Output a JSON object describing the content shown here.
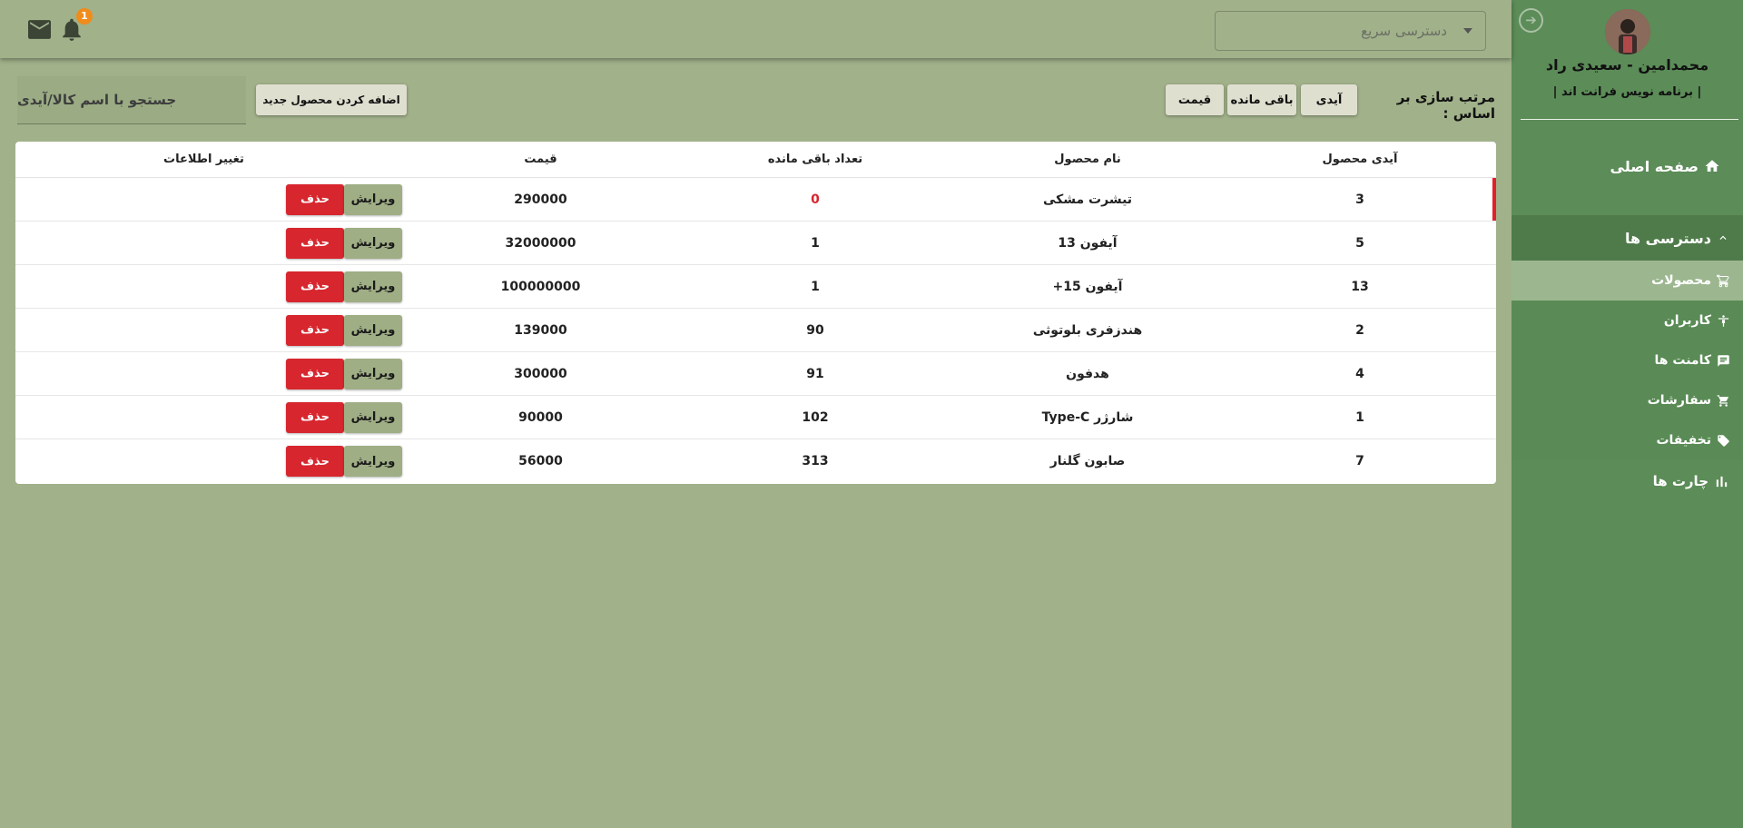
{
  "topbar": {
    "quick_access_placeholder": "دسترسی سریع",
    "notification_count": "1"
  },
  "sidebar": {
    "user_name": "محمدامین - سعیدی راد",
    "user_role": "| برنامه نویس فرانت اند |",
    "home_label": "صفحه اصلی",
    "group_label": "دسترسی ها",
    "items": [
      {
        "label": "محصولات",
        "icon": "cart-outline-icon",
        "active": true
      },
      {
        "label": "کاربران",
        "icon": "person-icon",
        "active": false
      },
      {
        "label": "کامنت ها",
        "icon": "comment-icon",
        "active": false
      },
      {
        "label": "سفارشات",
        "icon": "cart-icon",
        "active": false
      },
      {
        "label": "تخفیفات",
        "icon": "tag-icon",
        "active": false
      }
    ],
    "charts_label": "چارت ها"
  },
  "controls": {
    "sort_label": "مرتب سازی بر اساس :",
    "sort_options": [
      "آیدی",
      "باقی مانده",
      "قیمت"
    ],
    "add_button": "اضافه کردن محصول جدید",
    "search_placeholder": "جستجو با اسم کالا/آیدی"
  },
  "table": {
    "headers": [
      "آیدی محصول",
      "نام محصول",
      "تعداد باقی مانده",
      "قیمت",
      "تغییر اطلاعات"
    ],
    "edit_label": "ویرایش",
    "delete_label": "حذف",
    "rows": [
      {
        "id": "3",
        "name": "تیشرت مشکی",
        "stock": "0",
        "price": "290000",
        "out_of_stock": true
      },
      {
        "id": "5",
        "name": "آیفون 13",
        "stock": "1",
        "price": "32000000",
        "out_of_stock": false
      },
      {
        "id": "13",
        "name": "آیفون 15+",
        "stock": "1",
        "price": "100000000",
        "out_of_stock": false
      },
      {
        "id": "2",
        "name": "هندزفری بلوتوثی",
        "stock": "90",
        "price": "139000",
        "out_of_stock": false
      },
      {
        "id": "4",
        "name": "هدفون",
        "stock": "91",
        "price": "300000",
        "out_of_stock": false
      },
      {
        "id": "1",
        "name": "شارژر Type-C",
        "stock": "102",
        "price": "90000",
        "out_of_stock": false
      },
      {
        "id": "7",
        "name": "صابون گلنار",
        "stock": "313",
        "price": "56000",
        "out_of_stock": false
      }
    ]
  },
  "colors": {
    "background": "#a1b18a",
    "sidebar": "#5c8c58",
    "danger": "#d7262e",
    "badge": "#f08c1c"
  }
}
